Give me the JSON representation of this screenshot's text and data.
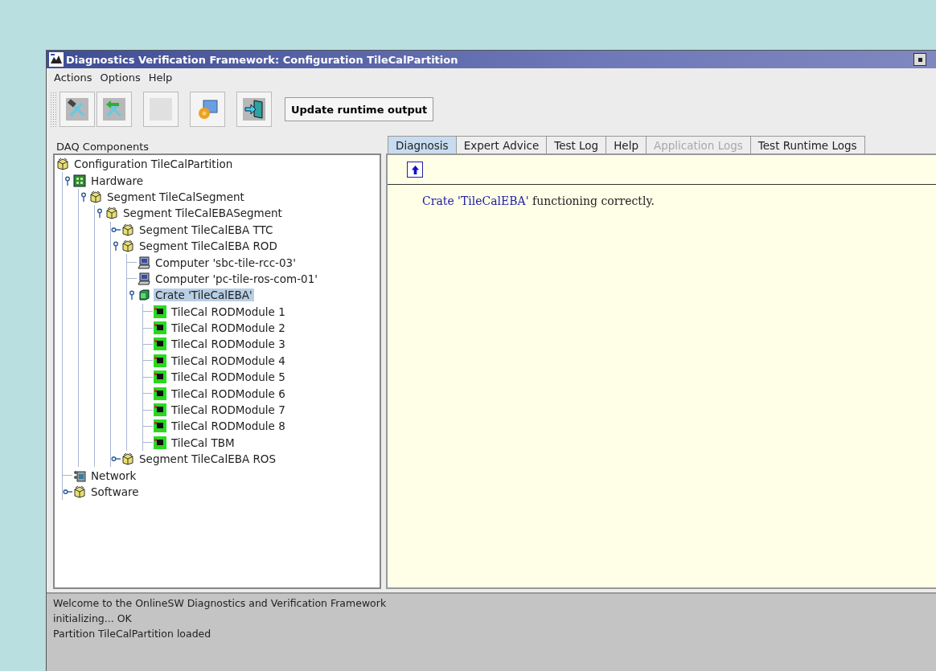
{
  "window": {
    "title": "Diagnostics Verification Framework: Configuration TileCalPartition"
  },
  "menu": [
    "Actions",
    "Options",
    "Help"
  ],
  "toolbar": {
    "tools": [
      {
        "kind": "tools",
        "disabled": false
      },
      {
        "kind": "tools-back",
        "disabled": false
      },
      {
        "kind": "blank",
        "disabled": true
      },
      {
        "kind": "monitor-gear",
        "disabled": false
      },
      {
        "kind": "exit",
        "disabled": false
      }
    ],
    "button": "Update runtime output"
  },
  "tree": {
    "title": "DAQ Components",
    "root": {
      "label": "Configuration TileCalPartition",
      "kind": "box",
      "selected": false,
      "children": [
        {
          "label": "Hardware",
          "kind": "hardware",
          "selected": false,
          "expanded": true,
          "children": [
            {
              "label": "Segment TileCalSegment",
              "kind": "box",
              "selected": false,
              "expanded": true,
              "children": [
                {
                  "label": "Segment TileCalEBASegment",
                  "kind": "box",
                  "selected": false,
                  "expanded": true,
                  "children": [
                    {
                      "label": "Segment TileCalEBA TTC",
                      "kind": "box",
                      "selected": false,
                      "expanded": false
                    },
                    {
                      "label": "Segment TileCalEBA ROD",
                      "kind": "box",
                      "selected": false,
                      "expanded": true,
                      "children": [
                        {
                          "label": "Computer 'sbc-tile-rcc-03'",
                          "kind": "computer",
                          "selected": false
                        },
                        {
                          "label": "Computer 'pc-tile-ros-com-01'",
                          "kind": "computer",
                          "selected": false
                        },
                        {
                          "label": "Crate 'TileCalEBA'",
                          "kind": "crate",
                          "selected": true,
                          "expanded": true,
                          "children": [
                            {
                              "label": "TileCal RODModule 1",
                              "kind": "module",
                              "selected": false
                            },
                            {
                              "label": "TileCal RODModule 2",
                              "kind": "module",
                              "selected": false
                            },
                            {
                              "label": "TileCal RODModule 3",
                              "kind": "module",
                              "selected": false
                            },
                            {
                              "label": "TileCal RODModule 4",
                              "kind": "module",
                              "selected": false
                            },
                            {
                              "label": "TileCal RODModule 5",
                              "kind": "module",
                              "selected": false
                            },
                            {
                              "label": "TileCal RODModule 6",
                              "kind": "module",
                              "selected": false
                            },
                            {
                              "label": "TileCal RODModule 7",
                              "kind": "module",
                              "selected": false
                            },
                            {
                              "label": "TileCal RODModule 8",
                              "kind": "module",
                              "selected": false
                            },
                            {
                              "label": "TileCal TBM",
                              "kind": "module",
                              "selected": false
                            }
                          ]
                        }
                      ]
                    },
                    {
                      "label": "Segment TileCalEBA ROS",
                      "kind": "box",
                      "selected": false,
                      "expanded": false
                    }
                  ]
                }
              ]
            }
          ]
        },
        {
          "label": "Network",
          "kind": "network",
          "selected": false
        },
        {
          "label": "Software",
          "kind": "box",
          "selected": false,
          "expanded": false
        }
      ]
    }
  },
  "tabs": [
    {
      "label": "Diagnosis",
      "selected": true,
      "disabled": false
    },
    {
      "label": "Expert Advice",
      "selected": false,
      "disabled": false
    },
    {
      "label": "Test Log",
      "selected": false,
      "disabled": false
    },
    {
      "label": "Help",
      "selected": false,
      "disabled": false
    },
    {
      "label": "Application Logs",
      "selected": false,
      "disabled": true
    },
    {
      "label": "Test Runtime Logs",
      "selected": false,
      "disabled": false
    }
  ],
  "diagnosis": {
    "link": "Crate 'TileCalEBA'",
    "text": " functioning correctly."
  },
  "log": [
    "Welcome to the OnlineSW Diagnostics and Verification Framework",
    "initializing... OK",
    "Partition TileCalPartition loaded"
  ]
}
